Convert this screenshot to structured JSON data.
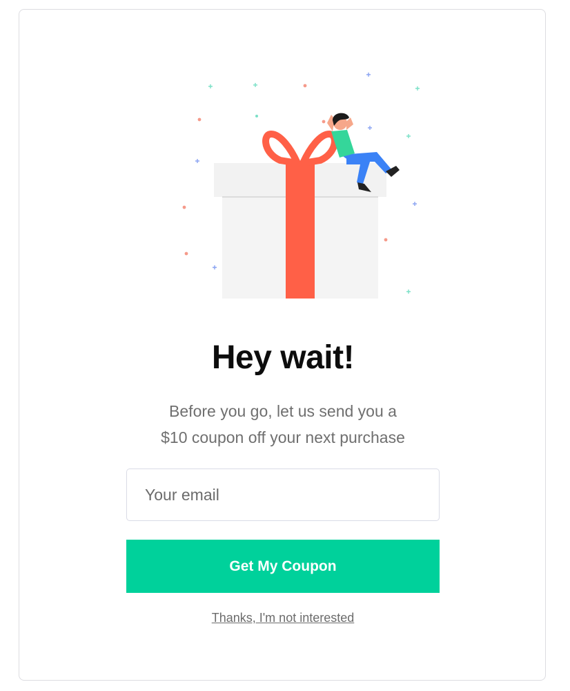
{
  "popup": {
    "title": "Hey wait!",
    "subtitle_line1": "Before you go, let us send you a",
    "subtitle_line2": "$10 coupon off your next purchase",
    "email_placeholder": "Your email",
    "email_value": "",
    "cta_label": "Get My Coupon",
    "decline_label": "Thanks, I'm not interested"
  },
  "colors": {
    "accent": "#00d19b",
    "ribbon": "#ff6047",
    "box": "#f4f4f4",
    "person_shirt": "#35d69a",
    "person_pants": "#3b82f6"
  },
  "illustration": {
    "icons": [
      "gift-box-icon",
      "ribbon-bow-icon",
      "person-icon",
      "confetti-icon"
    ]
  }
}
